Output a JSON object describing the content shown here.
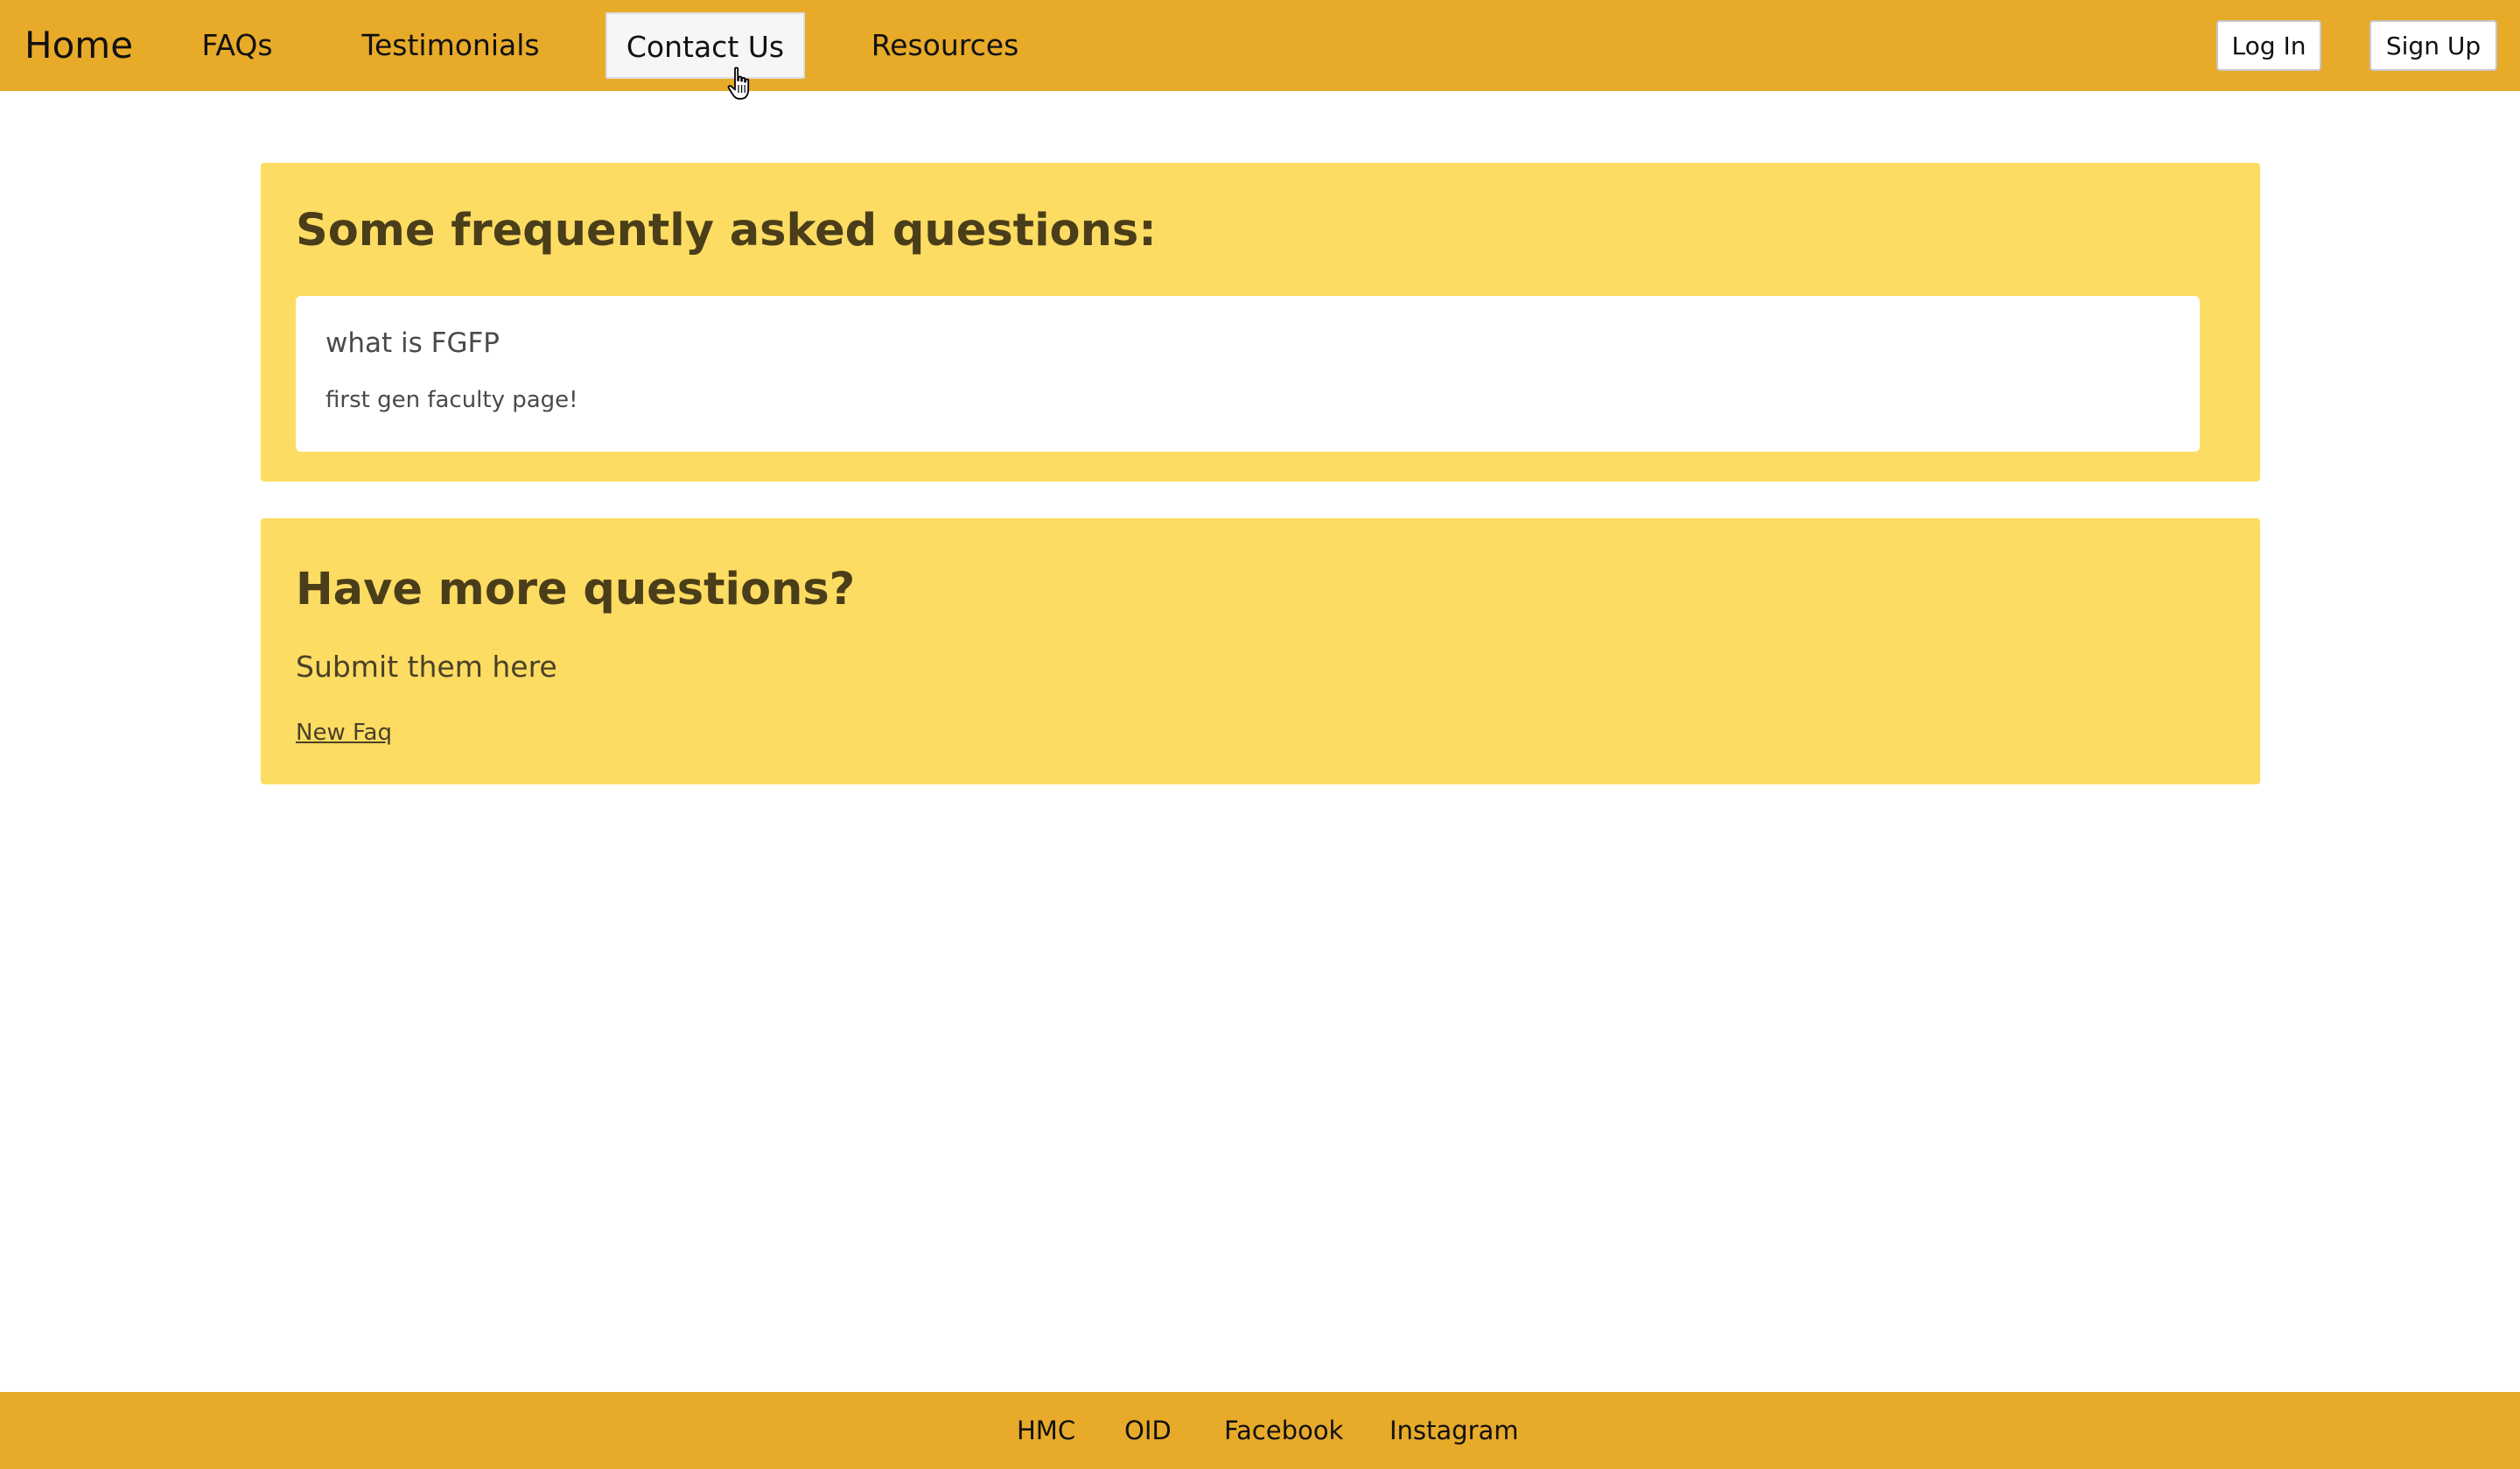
{
  "nav": {
    "brand": "Home",
    "links": [
      {
        "label": "FAQs"
      },
      {
        "label": "Testimonials"
      },
      {
        "label": "Contact Us"
      },
      {
        "label": "Resources"
      }
    ],
    "active": "Contact Us",
    "login_label": "Log In",
    "signup_label": "Sign Up"
  },
  "faq_section": {
    "title": "Some frequently asked questions:",
    "items": [
      {
        "question": "what is FGFP",
        "answer": "first gen faculty page!"
      }
    ]
  },
  "more_section": {
    "title": "Have more questions?",
    "subtitle": "Submit them here",
    "link_label": "New Faq"
  },
  "footer": {
    "links": [
      {
        "label": "HMC"
      },
      {
        "label": "OID"
      },
      {
        "label": "Facebook"
      },
      {
        "label": "Instagram"
      }
    ]
  },
  "colors": {
    "header_bg": "#e8aa29",
    "card_bg": "#fcdc62",
    "heading_text": "#4a3d19"
  },
  "icons": {
    "cursor": "hand-pointer-icon"
  }
}
